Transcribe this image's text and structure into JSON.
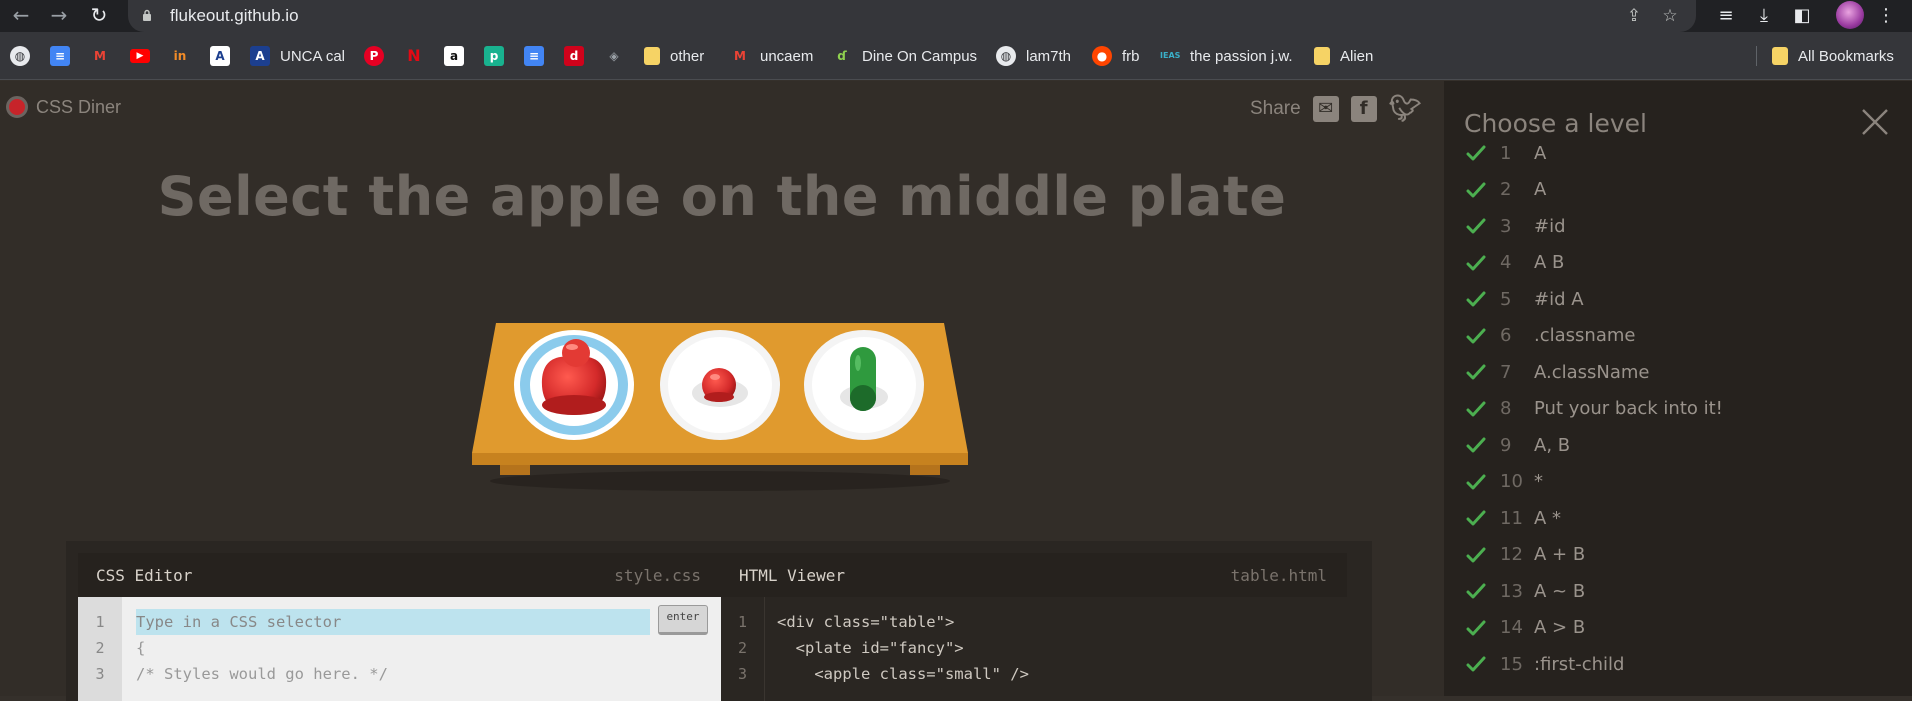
{
  "browser": {
    "url": "flukeout.github.io",
    "bookmarks": [
      {
        "label": "",
        "icon": "globe-icon"
      },
      {
        "label": "",
        "icon": "google-docs-icon"
      },
      {
        "label": "",
        "icon": "gmail-icon"
      },
      {
        "label": "",
        "icon": "youtube-icon"
      },
      {
        "label": "",
        "icon": "in-icon"
      },
      {
        "label": "",
        "icon": "a-logo-icon"
      },
      {
        "label": "UNCA cal",
        "icon": "unca-icon"
      },
      {
        "label": "",
        "icon": "pinterest-icon"
      },
      {
        "label": "",
        "icon": "netflix-icon"
      },
      {
        "label": "",
        "icon": "amazon-icon"
      },
      {
        "label": "",
        "icon": "green-app-icon"
      },
      {
        "label": "",
        "icon": "google-docs-icon"
      },
      {
        "label": "",
        "icon": "red-app-icon"
      },
      {
        "label": "",
        "icon": "layers-icon"
      },
      {
        "label": "other",
        "icon": "folder-icon"
      },
      {
        "label": "uncaem",
        "icon": "gmail-icon"
      },
      {
        "label": "Dine On Campus",
        "icon": "dine-icon"
      },
      {
        "label": "lam7th",
        "icon": "globe-icon"
      },
      {
        "label": "frb",
        "icon": "reddit-icon"
      },
      {
        "label": "the passion j.w.",
        "icon": "ieas-icon"
      },
      {
        "label": "Alien",
        "icon": "folder-icon"
      }
    ],
    "all_bookmarks": "All Bookmarks"
  },
  "app": {
    "logo": "CSS Diner",
    "share": "Share",
    "order": "Select the apple on the middle plate",
    "css_editor": {
      "title": "CSS Editor",
      "file": "style.css",
      "placeholder": "Type in a CSS selector",
      "lines": [
        "{",
        "/* Styles would go here. */"
      ],
      "line_numbers": [
        "1",
        "2",
        "3"
      ],
      "enter": "enter"
    },
    "html_viewer": {
      "title": "HTML Viewer",
      "file": "table.html",
      "lines": [
        "<div class=\"table\">",
        "  <plate id=\"fancy\">",
        "    <apple class=\"small\" />"
      ],
      "line_numbers": [
        "1",
        "2",
        "3"
      ]
    }
  },
  "levels": {
    "title": "Choose a level",
    "items": [
      {
        "num": "1",
        "name": "A",
        "done": true
      },
      {
        "num": "2",
        "name": "A",
        "done": true
      },
      {
        "num": "3",
        "name": "#id",
        "done": true
      },
      {
        "num": "4",
        "name": "A  B",
        "done": true
      },
      {
        "num": "5",
        "name": "#id  A",
        "done": true
      },
      {
        "num": "6",
        "name": ".classname",
        "done": true
      },
      {
        "num": "7",
        "name": "A.className",
        "done": true
      },
      {
        "num": "8",
        "name": "Put your back into it!",
        "done": true
      },
      {
        "num": "9",
        "name": "A, B",
        "done": true
      },
      {
        "num": "10",
        "name": "*",
        "done": true
      },
      {
        "num": "11",
        "name": "A  *",
        "done": true
      },
      {
        "num": "12",
        "name": "A + B",
        "done": true
      },
      {
        "num": "13",
        "name": "A ~ B",
        "done": true
      },
      {
        "num": "14",
        "name": "A > B",
        "done": true
      },
      {
        "num": "15",
        "name": ":first-child",
        "done": true
      }
    ]
  },
  "colors": {
    "check": "#4caf50",
    "table": "#e09a2e",
    "apple": "#d42a2a",
    "pickle": "#2f9a3e"
  }
}
